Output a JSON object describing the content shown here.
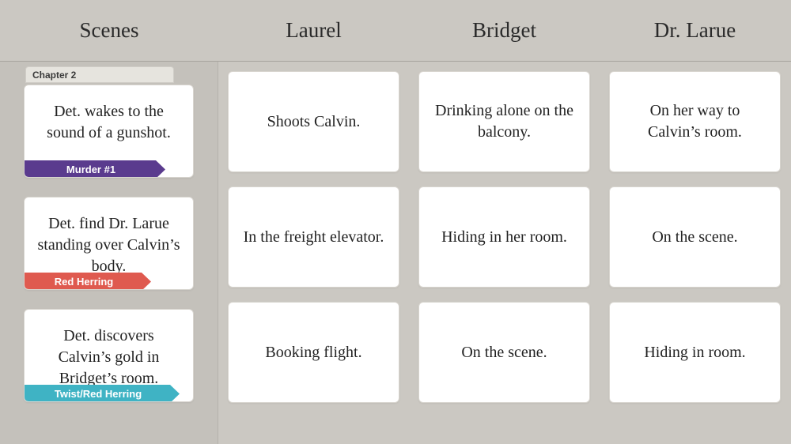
{
  "header": {
    "columns": [
      "Scenes",
      "Laurel",
      "Bridget",
      "Dr. Larue"
    ]
  },
  "chapter_label": "Chapter 2",
  "scenes": [
    {
      "text": "Det. wakes to the sound of a gunshot.",
      "tag": "Murder #1",
      "tag_class": "tag-murder"
    },
    {
      "text": "Det. find Dr. Larue standing over Calvin’s body.",
      "tag": "Red Herring",
      "tag_class": "tag-herring"
    },
    {
      "text": "Det. discovers Calvin’s gold in Bridget’s room.",
      "tag": "Twist/Red Herring",
      "tag_class": "tag-twist"
    }
  ],
  "grid": {
    "laurel": [
      "Shoots Calvin.",
      "In the freight elevator.",
      "Booking flight."
    ],
    "bridget": [
      "Drinking alone on the balcony.",
      "Hiding in her room.",
      "On the scene."
    ],
    "drlarue": [
      "On her way to Calvin’s room.",
      "On the scene.",
      "Hiding in room."
    ]
  }
}
